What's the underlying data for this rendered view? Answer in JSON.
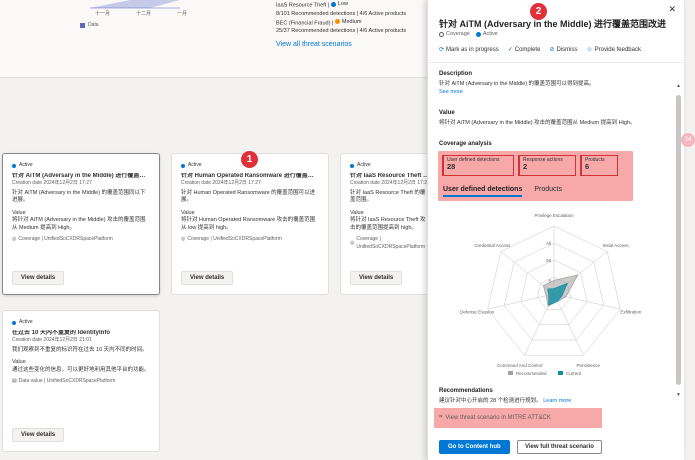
{
  "background": {
    "mini_chart": {
      "axis_labels": [
        "十一月",
        "十二月",
        "一月"
      ],
      "legend_label": "Data"
    },
    "threat_rows": [
      {
        "text": "IaaS Resource Theft",
        "severity_label": "Low"
      },
      {
        "text": "8/101 Recommended detections | 4/6 Active products"
      },
      {
        "text": "BEC (Financial Fraud)",
        "severity_label": "Medium"
      },
      {
        "text": "25/37 Recommended detections | 4/6 Active products"
      }
    ],
    "view_all_label": "View all threat scenarios",
    "cards": [
      {
        "status": "Active",
        "title": "针对 AiTM (Adversary in the Middle) 进行覆盖范围...",
        "date": "Creation date 2024年12月2日 17:27",
        "description": "针对 AiTM (Adversary in the Middle) 的覆盖范围同以下进展。",
        "value_label": "Value",
        "value_text": "将针对 AiTM (Adversary in the Middle) 攻击的覆盖范围从 Medium 提高到 High。",
        "footer": "Coverage | UnifiedSoCXDRSpacePlatform",
        "button": "View details"
      },
      {
        "status": "Active",
        "title": "针对 Human Operated Ransomware 进行覆盖范围...",
        "date": "Creation date 2024年12月2日 17:27",
        "description": "针对 Human Operated Ransomware 的覆盖范围可以进展。",
        "value_label": "Value",
        "value_text": "将针对 Human Operated Ransomware 攻击的覆盖范围从 low 提高到 high。",
        "footer": "Coverage | UnifiedSoCXDRSpacePlatform",
        "button": "View details"
      },
      {
        "status": "Active",
        "title": "针对 IaaS Resource Theft 进行...",
        "date": "Creation date 2024年12月2日 17:27",
        "description": "针对 IaaS Resource Theft 的覆盖范围。",
        "value_label": "Value",
        "value_text": "将针对 IaaS Resource Theft 攻击的覆盖范围提高到 high。",
        "footer": "Coverage | UnifiedSoCXDRSpacePlatform",
        "button": "View details"
      },
      {
        "status": "Active",
        "title": "在过去 10 天内不重复的 IdentityInfo",
        "date": "Creation date 2024年12月2日 21:01",
        "description": "我们观察到不重复的标识符在过去 10 天内不同的时间。",
        "value_label": "Value",
        "value_text": "通过这些变化的信息，可以更好地利用其他平台的功能。",
        "footer": "Data value | UnifiedSoCXDRSpacePlatform",
        "button": "View details"
      }
    ],
    "callout_1": "1"
  },
  "panel": {
    "callout_2": "2",
    "title": "针对 AiTM (Adversary in the Middle) 进行覆盖范围改进",
    "tags": [
      {
        "label": "Coverage"
      },
      {
        "label": "Active"
      }
    ],
    "actions": [
      {
        "icon": "refresh-icon",
        "glyph": "⟳",
        "label": "Mark as in progress"
      },
      {
        "icon": "check-icon",
        "glyph": "✓",
        "label": "Complete"
      },
      {
        "icon": "dismiss-icon",
        "glyph": "⊘",
        "label": "Dismiss"
      },
      {
        "icon": "feedback-icon",
        "glyph": "☺",
        "label": "Provide feedback"
      }
    ],
    "description_label": "Description",
    "description_text": "针对 AiTM (Adversary in the Middle) 的覆盖范围可以得到提高。",
    "see_more": "See more",
    "value_label": "Value",
    "value_text": "将针对 AiTM (Adversary in the Middle) 攻击的覆盖范围从 Medium 提高到 High。",
    "coverage_label": "Coverage analysis",
    "coverage_boxes": [
      {
        "label": "User defined detections",
        "value": "28"
      },
      {
        "label": "Response actions",
        "value": "2"
      },
      {
        "label": "Products",
        "value": "6"
      }
    ],
    "coverage_tabs": [
      "User defined detections",
      "Products"
    ],
    "radar": {
      "axes": [
        "Privilege Escalation",
        "Initial Access",
        "Exfiltration",
        "Persistence",
        "Command And Control",
        "Defense Evasion",
        "Credential Access"
      ],
      "ring_labels": [
        "All",
        "28",
        "8"
      ],
      "legend": [
        "Recommended",
        "Current"
      ],
      "recommended": [
        0.2,
        0.45,
        0.18,
        0.12,
        0.2,
        0.12,
        0.2
      ],
      "current": [
        0.08,
        0.25,
        0.12,
        0.12,
        0.18,
        0.08,
        0.12
      ],
      "recommended_color": "#a19f9d",
      "current_color": "#0f8fa3"
    },
    "recommendations_label": "Recommendations",
    "recommendations_text": "建议针对中心开启的 28 个检测进行规划。",
    "learn_more": "Learn more",
    "threat_link": "View threat scenario in MITRE ATT&CK",
    "primary_button": "Go to Content hub",
    "secondary_button": "View full threat scenario",
    "side_bubble": "24"
  }
}
